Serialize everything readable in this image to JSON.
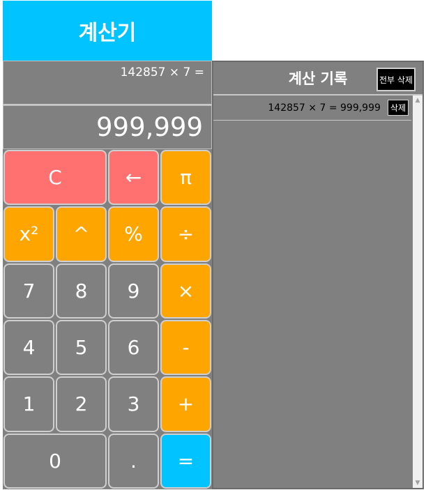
{
  "app": {
    "title": "계산기"
  },
  "display": {
    "expression": "142857 × 7 =",
    "result": "999,999"
  },
  "keypad": {
    "clear": "C",
    "backspace": "←",
    "pi": "π",
    "square": "x²",
    "power": "^",
    "percent": "%",
    "divide": "÷",
    "seven": "7",
    "eight": "8",
    "nine": "9",
    "multiply": "×",
    "four": "4",
    "five": "5",
    "six": "6",
    "minus": "-",
    "one": "1",
    "two": "2",
    "three": "3",
    "plus": "+",
    "zero": "0",
    "decimal": ".",
    "equals": "="
  },
  "history": {
    "title": "계산 기록",
    "clear_all_label": "전부 삭제",
    "items": [
      {
        "expression": "142857 × 7 = 999,999",
        "delete_label": "삭제"
      }
    ]
  },
  "colors": {
    "accent_blue": "#00c3ff",
    "operator_orange": "#ffa500",
    "clear_red": "#ff7070",
    "panel_gray": "#808080"
  }
}
